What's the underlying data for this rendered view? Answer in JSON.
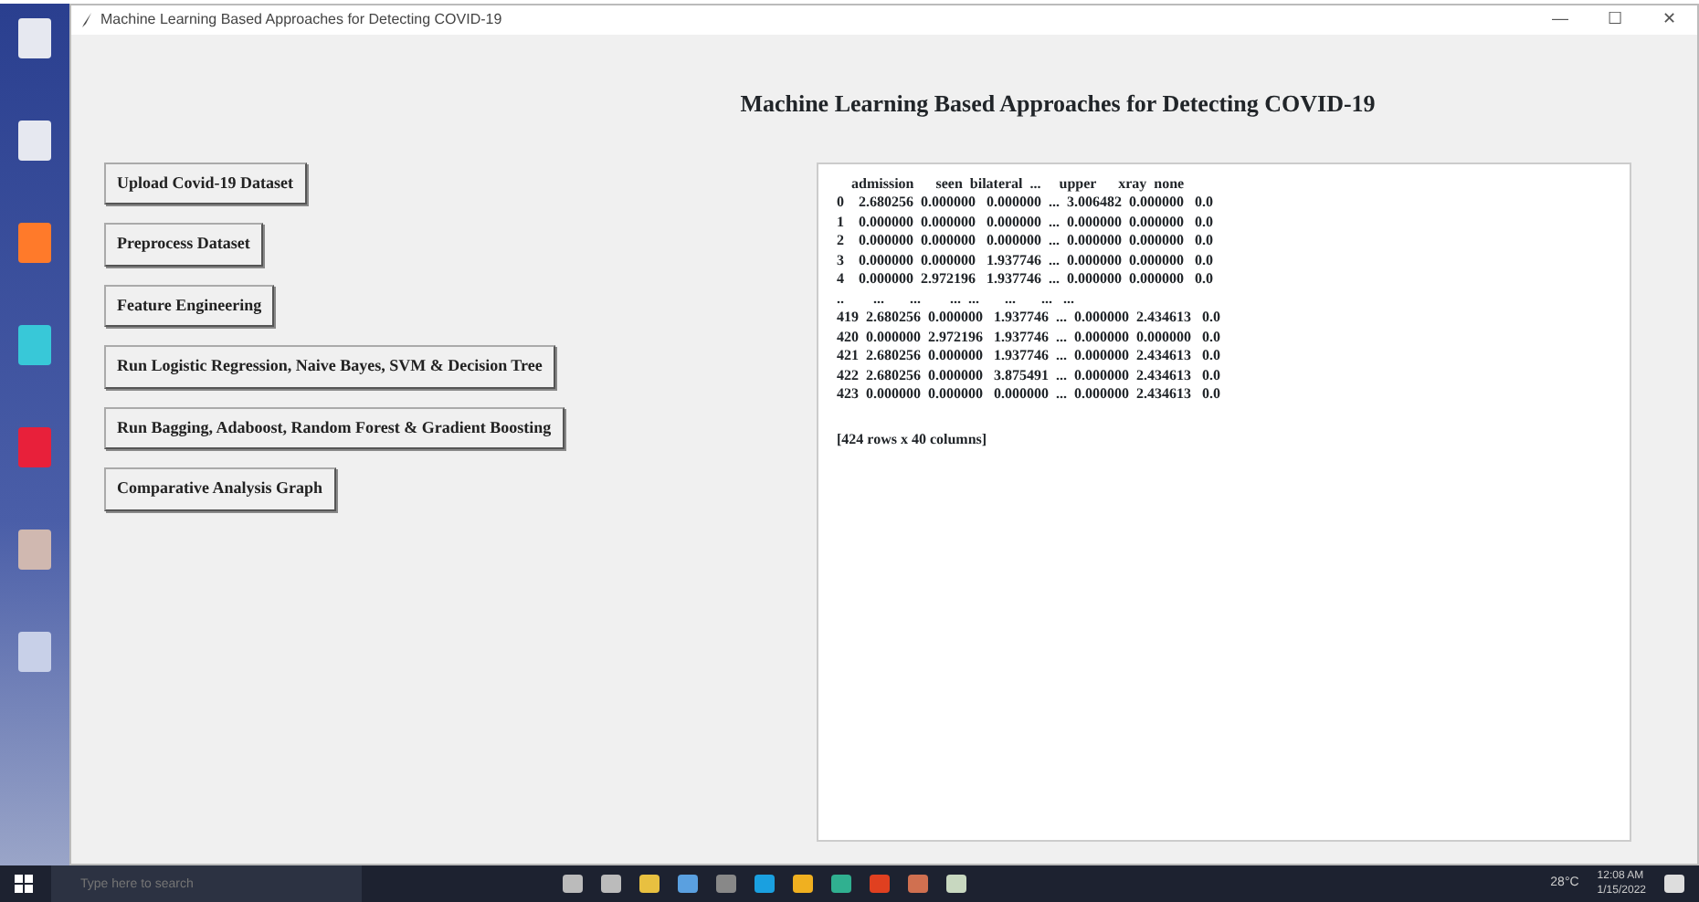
{
  "window": {
    "title": "Machine Learning Based Approaches for Detecting COVID-19",
    "controls": [
      "—",
      "☐",
      "✕"
    ]
  },
  "heading": "Machine Learning Based Approaches for Detecting COVID-19",
  "buttons": [
    {
      "label": "Upload Covid-19 Dataset"
    },
    {
      "label": "Preprocess Dataset"
    },
    {
      "label": "Feature Engineering"
    },
    {
      "label": "Run Logistic Regression, Naive Bayes, SVM & Decision Tree"
    },
    {
      "label": "Run Bagging, Adaboost, Random Forest & Gradient Boosting"
    },
    {
      "label": "Comparative Analysis Graph"
    }
  ],
  "output": {
    "lines": [
      "    admission      seen  bilateral  ...     upper      xray  none",
      "0    2.680256  0.000000   0.000000  ...  3.006482  0.000000   0.0",
      "1    0.000000  0.000000   0.000000  ...  0.000000  0.000000   0.0",
      "2    0.000000  0.000000   0.000000  ...  0.000000  0.000000   0.0",
      "3    0.000000  0.000000   1.937746  ...  0.000000  0.000000   0.0",
      "4    0.000000  2.972196   1.937746  ...  0.000000  0.000000   0.0",
      "..        ...       ...        ...  ...       ...       ...   ...",
      "419  2.680256  0.000000   1.937746  ...  0.000000  2.434613   0.0",
      "420  0.000000  2.972196   1.937746  ...  0.000000  0.000000   0.0",
      "421  2.680256  0.000000   1.937746  ...  0.000000  2.434613   0.0",
      "422  2.680256  0.000000   3.875491  ...  0.000000  2.434613   0.0",
      "423  0.000000  0.000000   0.000000  ...  0.000000  2.434613   0.0"
    ],
    "footer": "[424 rows x 40 columns]"
  },
  "taskbar": {
    "search_placeholder": "Type here to search",
    "weather": "28°C",
    "time": "12:08 AM",
    "date": "1/15/2022"
  }
}
